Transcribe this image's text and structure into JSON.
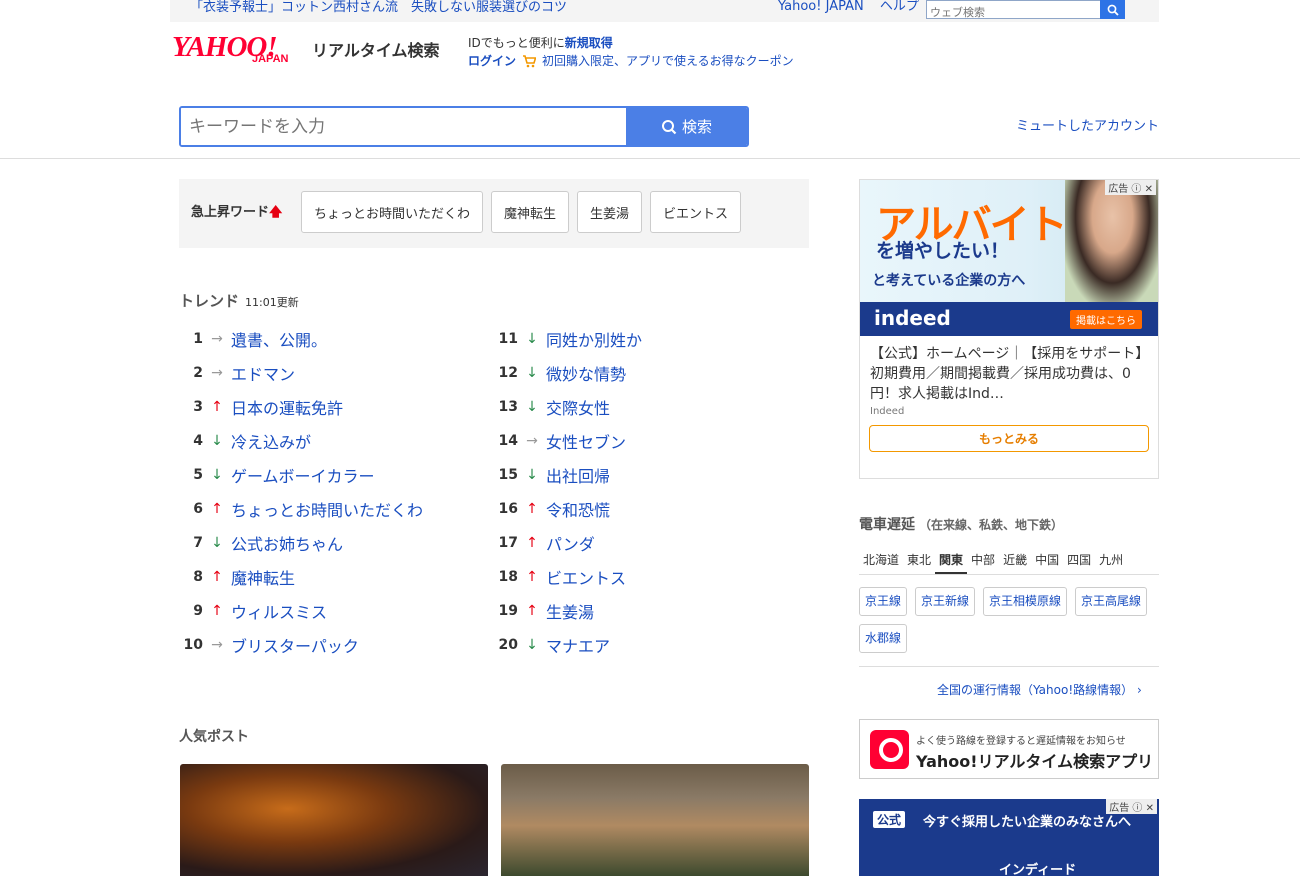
{
  "topbar": {
    "promo": "「衣装予報士」コットン西村さん流　失敗しない服装選びのコツ",
    "links": [
      "Yahoo! JAPAN",
      "ヘルプ"
    ],
    "web_search_placeholder": "ウェブ検索"
  },
  "header": {
    "logo_text": "YAHOO!",
    "logo_sub": "JAPAN",
    "service_name": "リアルタイム検索",
    "id_prompt": "IDでもっと便利に",
    "id_register": "新規取得",
    "login": "ログイン",
    "coupon": "初回購入限定、アプリで使えるお得なクーポン"
  },
  "search": {
    "placeholder": "キーワードを入力",
    "button": "検索",
    "muted_accounts": "ミュートしたアカウント"
  },
  "rising": {
    "label": "急上昇ワード",
    "chips": [
      "ちょっとお時間いただくわ",
      "魔神転生",
      "生姜湯",
      "ビエントス"
    ]
  },
  "trend": {
    "title": "トレンド",
    "updated": "11:01更新",
    "col1": [
      {
        "rank": "1",
        "dir": "flat",
        "word": "遺書、公開。"
      },
      {
        "rank": "2",
        "dir": "flat",
        "word": "エドマン"
      },
      {
        "rank": "3",
        "dir": "up",
        "word": "日本の運転免許"
      },
      {
        "rank": "4",
        "dir": "down",
        "word": "冷え込みが"
      },
      {
        "rank": "5",
        "dir": "down",
        "word": "ゲームボーイカラー"
      },
      {
        "rank": "6",
        "dir": "up",
        "word": "ちょっとお時間いただくわ"
      },
      {
        "rank": "7",
        "dir": "down",
        "word": "公式お姉ちゃん"
      },
      {
        "rank": "8",
        "dir": "up",
        "word": "魔神転生"
      },
      {
        "rank": "9",
        "dir": "up",
        "word": "ウィルスミス"
      },
      {
        "rank": "10",
        "dir": "flat",
        "word": "ブリスターパック"
      }
    ],
    "col2": [
      {
        "rank": "11",
        "dir": "down",
        "word": "同姓か別姓か"
      },
      {
        "rank": "12",
        "dir": "down",
        "word": "微妙な情勢"
      },
      {
        "rank": "13",
        "dir": "down",
        "word": "交際女性"
      },
      {
        "rank": "14",
        "dir": "flat",
        "word": "女性セブン"
      },
      {
        "rank": "15",
        "dir": "down",
        "word": "出社回帰"
      },
      {
        "rank": "16",
        "dir": "up",
        "word": "令和恐慌"
      },
      {
        "rank": "17",
        "dir": "up",
        "word": "パンダ"
      },
      {
        "rank": "18",
        "dir": "up",
        "word": "ビエントス"
      },
      {
        "rank": "19",
        "dir": "up",
        "word": "生姜湯"
      },
      {
        "rank": "20",
        "dir": "down",
        "word": "マナエア"
      }
    ]
  },
  "popular": {
    "title": "人気ポスト"
  },
  "ad1": {
    "tag": "広告",
    "headline": "アルバイト",
    "sub1": "を増やしたい！",
    "sub2": "と考えている企業の方へ",
    "brand": "indeed",
    "cta_img": "掲載はこちら",
    "text": "【公式】ホームページ｜【採用をサポート】初期費用／期間掲載費／採用成功費は、0円！求人掲載はInd…",
    "source": "Indeed",
    "more": "もっとみる"
  },
  "train": {
    "title": "電車遅延",
    "subtitle": "（在来線、私鉄、地下鉄）",
    "regions": [
      "北海道",
      "東北",
      "関東",
      "中部",
      "近畿",
      "中国",
      "四国",
      "九州"
    ],
    "active_region": "関東",
    "lines": [
      "京王線",
      "京王新線",
      "京王相模原線",
      "京王高尾線",
      "水郡線"
    ],
    "all_routes": "全国の運行情報（Yahoo!路線情報）"
  },
  "app": {
    "small": "よく使う路線を登録すると遅延情報をお知らせ",
    "name": "Yahoo!リアルタイム検索アプリ"
  },
  "ad2": {
    "tag": "広告",
    "badge": "公式",
    "title": "今すぐ採用したい企業のみなさんへ",
    "brand": "インディード"
  },
  "colors": {
    "link": "#1a4ec0",
    "accent": "#4b7fe6",
    "up": "#e60012",
    "down": "#2a8b4c",
    "brand": "#ff0033"
  }
}
